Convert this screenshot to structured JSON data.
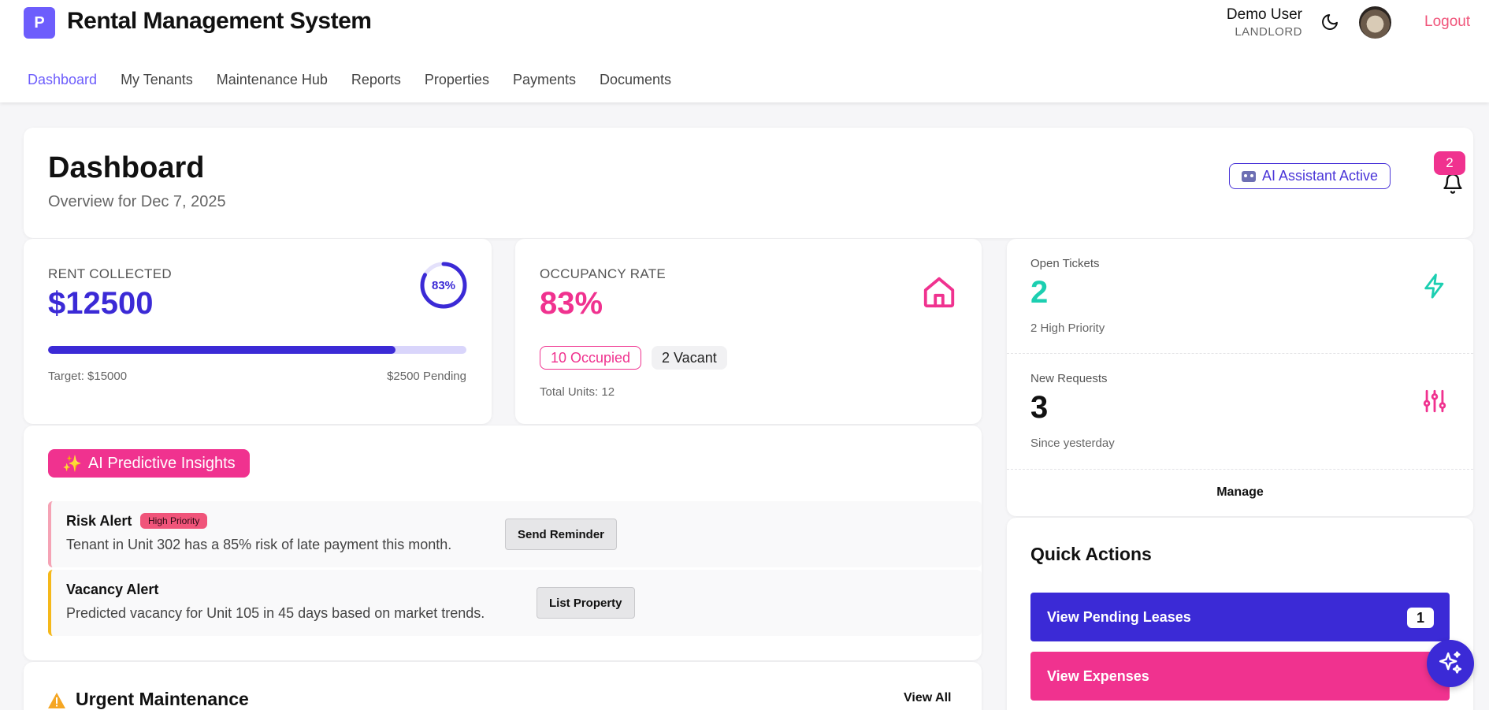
{
  "header": {
    "logo_letter": "P",
    "app_title": "Rental Management System",
    "user_name": "Demo User",
    "user_role": "LANDLORD",
    "logout_label": "Logout"
  },
  "nav": [
    {
      "label": "Dashboard",
      "active": true
    },
    {
      "label": "My Tenants"
    },
    {
      "label": "Maintenance Hub"
    },
    {
      "label": "Reports"
    },
    {
      "label": "Properties"
    },
    {
      "label": "Payments"
    },
    {
      "label": "Documents"
    }
  ],
  "page": {
    "title": "Dashboard",
    "subtitle": "Overview for Dec 7, 2025",
    "ai_badge": "AI Assistant Active",
    "notification_count": "2"
  },
  "rent": {
    "label": "RENT COLLECTED",
    "value": "$12500",
    "percent_label": "83%",
    "progress_fraction": 0.83,
    "target": "Target: $15000",
    "pending": "$2500 Pending"
  },
  "occupancy": {
    "label": "OCCUPANCY RATE",
    "value": "83%",
    "occupied": "10 Occupied",
    "vacant": "2 Vacant",
    "total": "Total Units: 12"
  },
  "tickets": {
    "open_label": "Open Tickets",
    "open_value": "2",
    "open_sub": "2 High Priority",
    "new_label": "New Requests",
    "new_value": "3",
    "new_sub": "Since yesterday",
    "manage_label": "Manage"
  },
  "quick_actions": {
    "title": "Quick Actions",
    "items": [
      {
        "label": "View Pending Leases",
        "count": "1",
        "color": "#3b2ad6"
      },
      {
        "label": "View Expenses",
        "color": "#f0328f"
      }
    ]
  },
  "insights": {
    "badge": "AI Predictive Insights",
    "alerts": [
      {
        "title": "Risk Alert",
        "priority": "High Priority",
        "text": "Tenant in Unit 302 has a 85% risk of late payment this month.",
        "button": "Send Reminder",
        "color": "#f5a3b5"
      },
      {
        "title": "Vacancy Alert",
        "text": "Predicted vacancy for Unit 105 in 45 days based on market trends.",
        "button": "List Property",
        "color": "#f5b81a"
      }
    ]
  },
  "maintenance": {
    "title": "Urgent Maintenance",
    "view_all": "View All"
  },
  "colors": {
    "primary": "#3b2ad6",
    "accent": "#f0328f",
    "teal": "#1ccfb1"
  }
}
